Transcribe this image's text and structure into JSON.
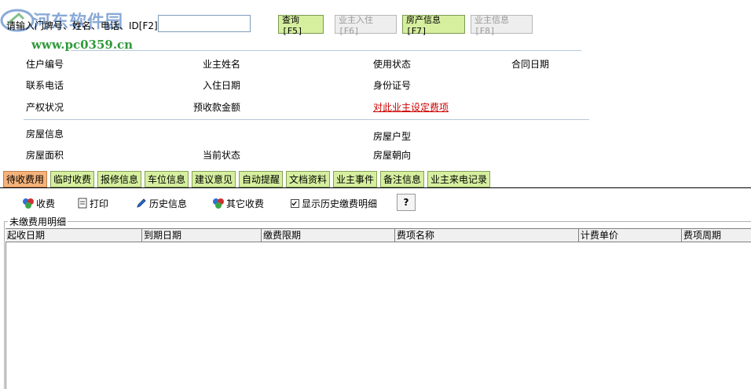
{
  "watermark": {
    "title": "河东软件园",
    "url": "www.pc0359.cn"
  },
  "search": {
    "label": "请输入门牌号、姓名、电话、ID[F2]",
    "value": "",
    "placeholder": ""
  },
  "buttons": {
    "query": "查询[F5]",
    "move_in": "业主入住[F6]",
    "house_info": "房产信息[F7]",
    "owner_info": "业主信息[F8]"
  },
  "info": {
    "household_no": "住户编号",
    "owner_name": "业主姓名",
    "usage_status": "使用状态",
    "contract_date": "合同日期",
    "phone": "联系电话",
    "move_in_date": "入住日期",
    "id_no": "身份证号",
    "property_status": "产权状况",
    "prepaid_amount": "预收款金额",
    "set_fees_link": "对此业主设定费项"
  },
  "house": {
    "house_info": "房屋信息",
    "house_type": "房屋户型",
    "house_area": "房屋面积",
    "current_status": "当前状态",
    "orientation": "房屋朝向"
  },
  "tabs": [
    "待收费用",
    "临时收费",
    "报修信息",
    "车位信息",
    "建议意见",
    "自动提醒",
    "文档资料",
    "业主事件",
    "备注信息",
    "业主来电记录"
  ],
  "toolbar": {
    "charge": "收费",
    "print": "打印",
    "history": "历史信息",
    "other_charge": "其它收费",
    "show_history": "显示历史缴费明细",
    "show_history_checked": true,
    "help": "?"
  },
  "table": {
    "title": "未缴费用明细",
    "columns": [
      "起收日期",
      "到期日期",
      "缴费限期",
      "费项名称",
      "计费单价",
      "费项周期"
    ]
  }
}
